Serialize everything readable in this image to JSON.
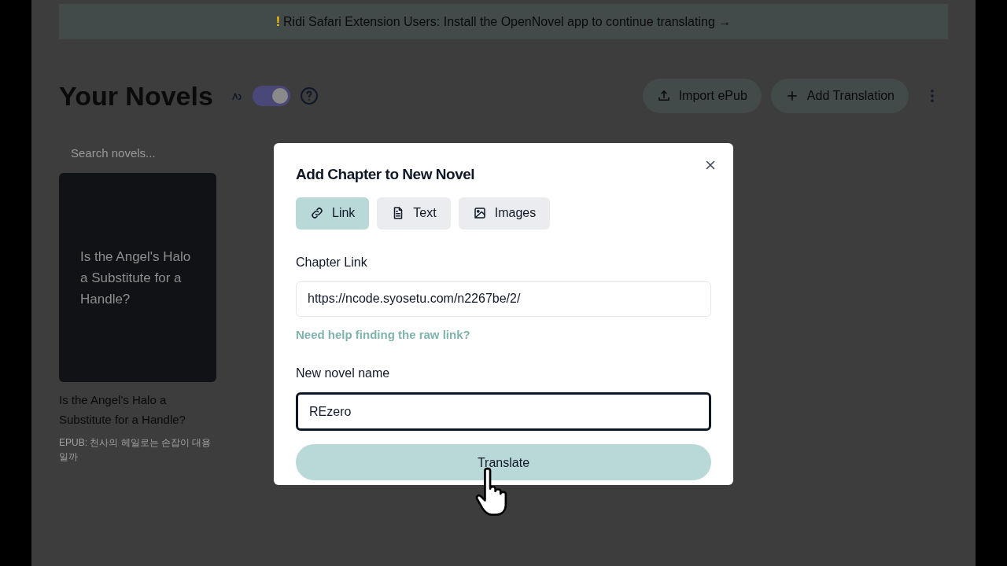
{
  "banner": {
    "icon": "!",
    "text": "Ridi Safari Extension Users: Install the OpenNovel app to continue translating →"
  },
  "header": {
    "title": "Your Novels",
    "toggle": {
      "on": true
    },
    "buttons": [
      {
        "kind": "upload",
        "label": "Import ePub"
      },
      {
        "kind": "add",
        "label": "Add Translation"
      }
    ]
  },
  "search": {
    "placeholder": "Search novels..."
  },
  "novels": [
    {
      "cover_text": "Is the Angel's Halo a Substitute for a Handle?",
      "title": "Is the Angel's Halo a Substitute for a Handle?",
      "subtitle": "EPUB: 천사의 헤일로는 손잡이 대용일까"
    }
  ],
  "modal": {
    "title": "Add Chapter to New Novel",
    "tabs": [
      {
        "kind": "link",
        "label": "Link",
        "selected": true
      },
      {
        "kind": "text",
        "label": "Text",
        "selected": false
      },
      {
        "kind": "images",
        "label": "Images",
        "selected": false
      }
    ],
    "chapter_link": {
      "label": "Chapter Link",
      "value": "https://ncode.syosetu.com/n2267be/2/"
    },
    "help_link": "Need help finding the raw link?",
    "novel_name": {
      "label": "New novel name",
      "value": "REzero",
      "focused": true
    },
    "submit": "Translate"
  }
}
